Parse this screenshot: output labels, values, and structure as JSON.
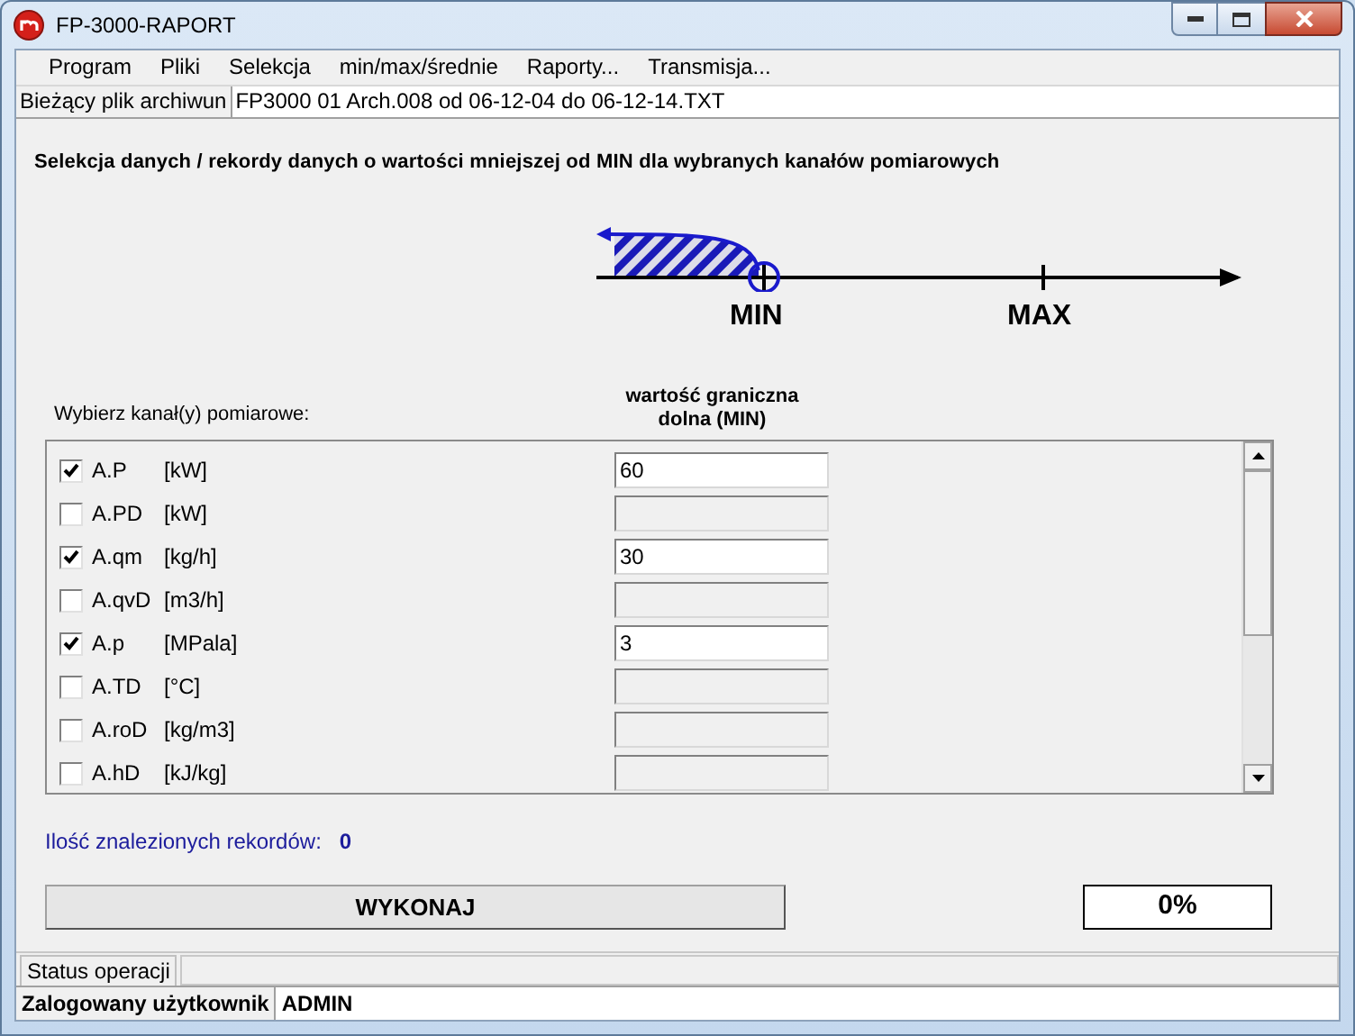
{
  "window": {
    "title": "FP-3000-RAPORT"
  },
  "menu": [
    {
      "label": "Program"
    },
    {
      "label": "Pliki"
    },
    {
      "label": "Selekcja"
    },
    {
      "label": "min/max/średnie"
    },
    {
      "label": "Raporty..."
    },
    {
      "label": "Transmisja..."
    }
  ],
  "archive": {
    "label": "Bieżący plik archiwun",
    "value": "FP3000 01 Arch.008 od 06-12-04 do 06-12-14.TXT"
  },
  "heading": "Selekcja danych / rekordy danych o wartości mniejszej od MIN dla wybranych kanałów pomiarowych",
  "diagram": {
    "min_label": "MIN",
    "max_label": "MAX"
  },
  "channels_label": "Wybierz kanał(y) pomiarowe:",
  "limit_heading": "wartość graniczna dolna (MIN)",
  "channels": [
    {
      "name": "A.P",
      "unit": "[kW]",
      "checked": true,
      "value": "60"
    },
    {
      "name": "A.PD",
      "unit": "[kW]",
      "checked": false
    },
    {
      "name": "A.qm",
      "unit": "[kg/h]",
      "checked": true,
      "value": "30"
    },
    {
      "name": "A.qvD",
      "unit": "[m3/h]",
      "checked": false
    },
    {
      "name": "A.p",
      "unit": "[MPala]",
      "checked": true,
      "value": "3"
    },
    {
      "name": "A.TD",
      "unit": "[°C]",
      "checked": false
    },
    {
      "name": "A.roD",
      "unit": "[kg/m3]",
      "checked": false
    },
    {
      "name": "A.hD",
      "unit": "[kJ/kg]",
      "checked": false
    }
  ],
  "records": {
    "label": "Ilość znalezionych rekordów:",
    "value": "0"
  },
  "run_button": "WYKONAJ",
  "progress": "0%",
  "status_tab": "Status operacji",
  "user": {
    "label": "Zalogowany użytkownik",
    "value": "ADMIN"
  }
}
